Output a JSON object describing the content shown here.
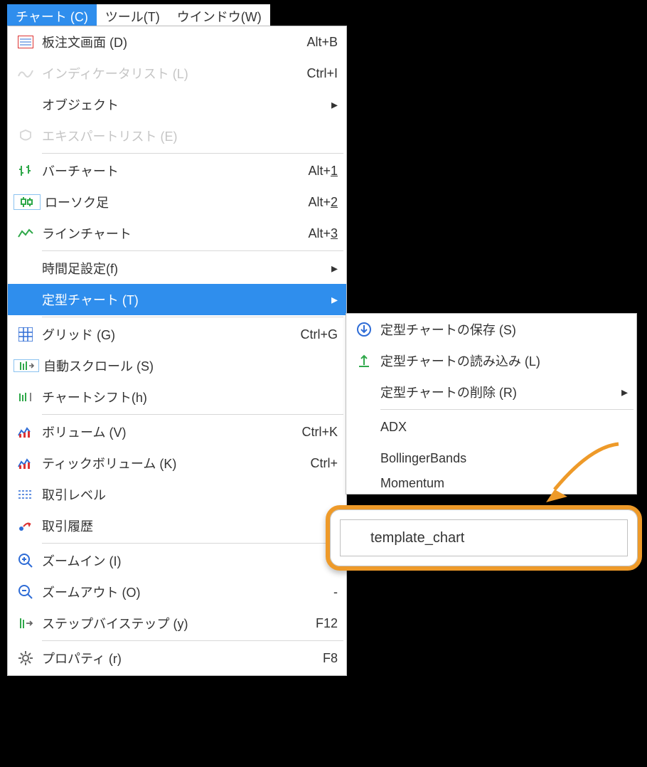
{
  "menubar": {
    "chart": "チャート (C)",
    "tools": "ツール(T)",
    "window": "ウインドウ(W)"
  },
  "menu": {
    "order_board": {
      "label": "板注文画面 (D)",
      "accel": "Alt+B"
    },
    "indicator_list": {
      "label": "インディケータリスト (L)",
      "accel": "Ctrl+I"
    },
    "objects": {
      "label": "オブジェクト"
    },
    "expert_list": {
      "label": "エキスパートリスト (E)"
    },
    "bar_chart": {
      "label": "バーチャート",
      "accel_pre": "Alt+",
      "accel_u": "1"
    },
    "candle": {
      "label": "ローソク足",
      "accel_pre": "Alt+",
      "accel_u": "2"
    },
    "line_chart": {
      "label": "ラインチャート",
      "accel_pre": "Alt+",
      "accel_u": "3"
    },
    "timeframe": {
      "label": "時間足設定(f)"
    },
    "templates": {
      "label": "定型チャート (T)"
    },
    "grid": {
      "label": "グリッド (G)",
      "accel": "Ctrl+G"
    },
    "auto_scroll": {
      "label": "自動スクロール (S)"
    },
    "chart_shift": {
      "label": "チャートシフト(h)"
    },
    "volume": {
      "label": "ボリューム (V)",
      "accel": "Ctrl+K"
    },
    "tick_volume": {
      "label": "ティックボリューム (K)",
      "accel": "Ctrl+"
    },
    "trade_levels": {
      "label": "取引レベル"
    },
    "trade_history": {
      "label": "取引履歴"
    },
    "zoom_in": {
      "label": "ズームイン (I)",
      "accel": "+"
    },
    "zoom_out": {
      "label": "ズームアウト (O)",
      "accel": "-"
    },
    "step_by_step": {
      "label": "ステップバイステップ (y)",
      "accel": "F12"
    },
    "properties": {
      "label": "プロパティ (r)",
      "accel": "F8"
    }
  },
  "submenu": {
    "save": {
      "label": "定型チャートの保存 (S)"
    },
    "load": {
      "label": "定型チャートの読み込み (L)"
    },
    "delete": {
      "label": "定型チャートの削除 (R)"
    },
    "adx": {
      "label": "ADX"
    },
    "bb": {
      "label": "BollingerBands"
    },
    "mom": {
      "label": "Momentum"
    }
  },
  "callout": {
    "template": "template_chart"
  }
}
